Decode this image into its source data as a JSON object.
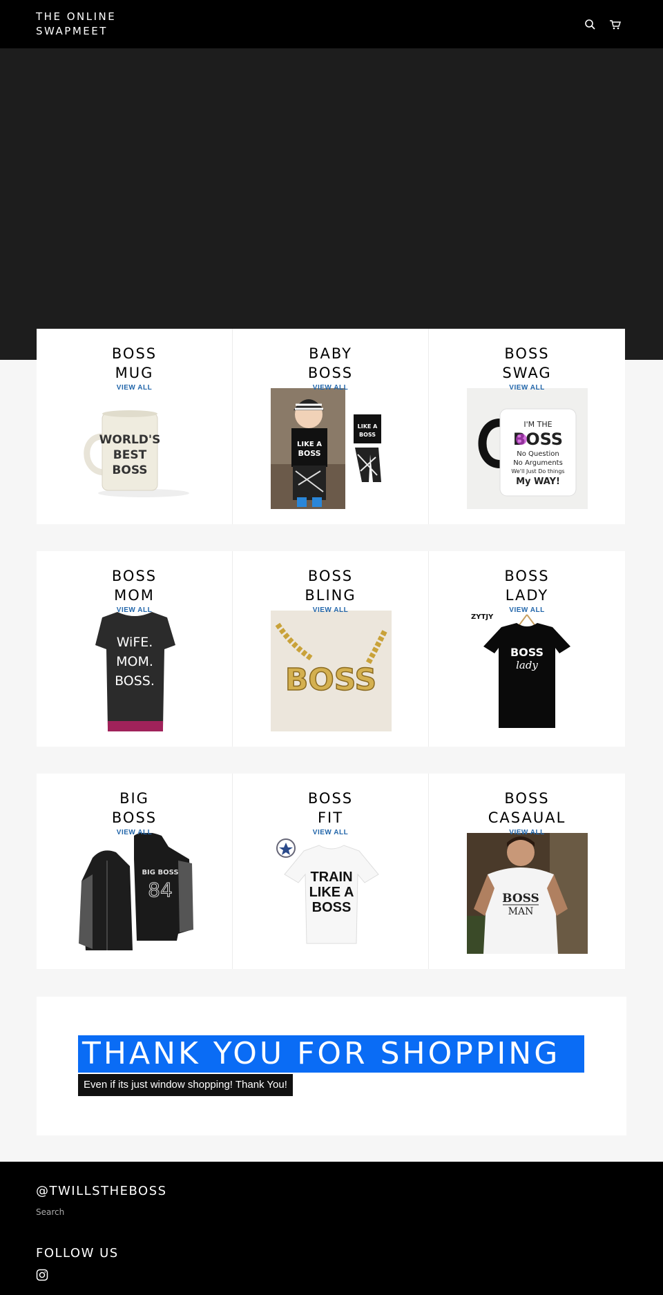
{
  "header": {
    "logo": "THE ONLINE SWAPMEET",
    "search_icon": "search-icon",
    "cart_icon": "cart-icon"
  },
  "collections": [
    {
      "title": "BOSS MUG",
      "link": "VIEW ALL",
      "image": "world's best boss mug"
    },
    {
      "title": "BABY BOSS",
      "link": "VIEW ALL",
      "image": "toddler in 'like a boss' outfit"
    },
    {
      "title": "BOSS SWAG",
      "link": "VIEW ALL",
      "image": "I'm the boss mug"
    },
    {
      "title": "BOSS MOM",
      "link": "VIEW ALL",
      "image": "wife mom boss t-shirt"
    },
    {
      "title": "BOSS BLING",
      "link": "VIEW ALL",
      "image": "gold boss necklace"
    },
    {
      "title": "BOSS LADY",
      "link": "VIEW ALL",
      "image": "boss lady t-shirt"
    },
    {
      "title": "BIG BOSS",
      "link": "VIEW ALL",
      "image": "big boss 84 hoodies"
    },
    {
      "title": "BOSS FIT",
      "link": "VIEW ALL",
      "image": "train like a boss t-shirt"
    },
    {
      "title": "BOSS CASAUAL",
      "link": "VIEW ALL",
      "image": "boss man t-shirt on model"
    }
  ],
  "image_text": {
    "mug1": [
      "WORLD'S",
      "BEST",
      "BOSS"
    ],
    "baby": [
      "LIKE A",
      "BOSS"
    ],
    "mug2": [
      "I'M THE",
      "BOSS",
      "No Question",
      "No Arguments",
      "We'll Just Do things",
      "My WAY!"
    ],
    "mom": [
      "WiFE.",
      "MOM.",
      "BOSS."
    ],
    "bling": "BOSS",
    "lady_brand": "ZYTJY",
    "lady": [
      "BOSS",
      "lady"
    ],
    "hoodie": [
      "BIG BOSS",
      "84"
    ],
    "fit": [
      "TRAIN",
      "LIKE A",
      "BOSS"
    ],
    "casual": [
      "BOSS",
      "MAN"
    ]
  },
  "promo": {
    "title": "THANK YOU FOR SHOPPING",
    "subtitle": "Even if its just window shopping! Thank You!"
  },
  "footer": {
    "handle": "@TWILLSTHEBOSS",
    "search_link": "Search",
    "follow_heading": "FOLLOW US",
    "instagram_icon": "instagram-icon"
  }
}
